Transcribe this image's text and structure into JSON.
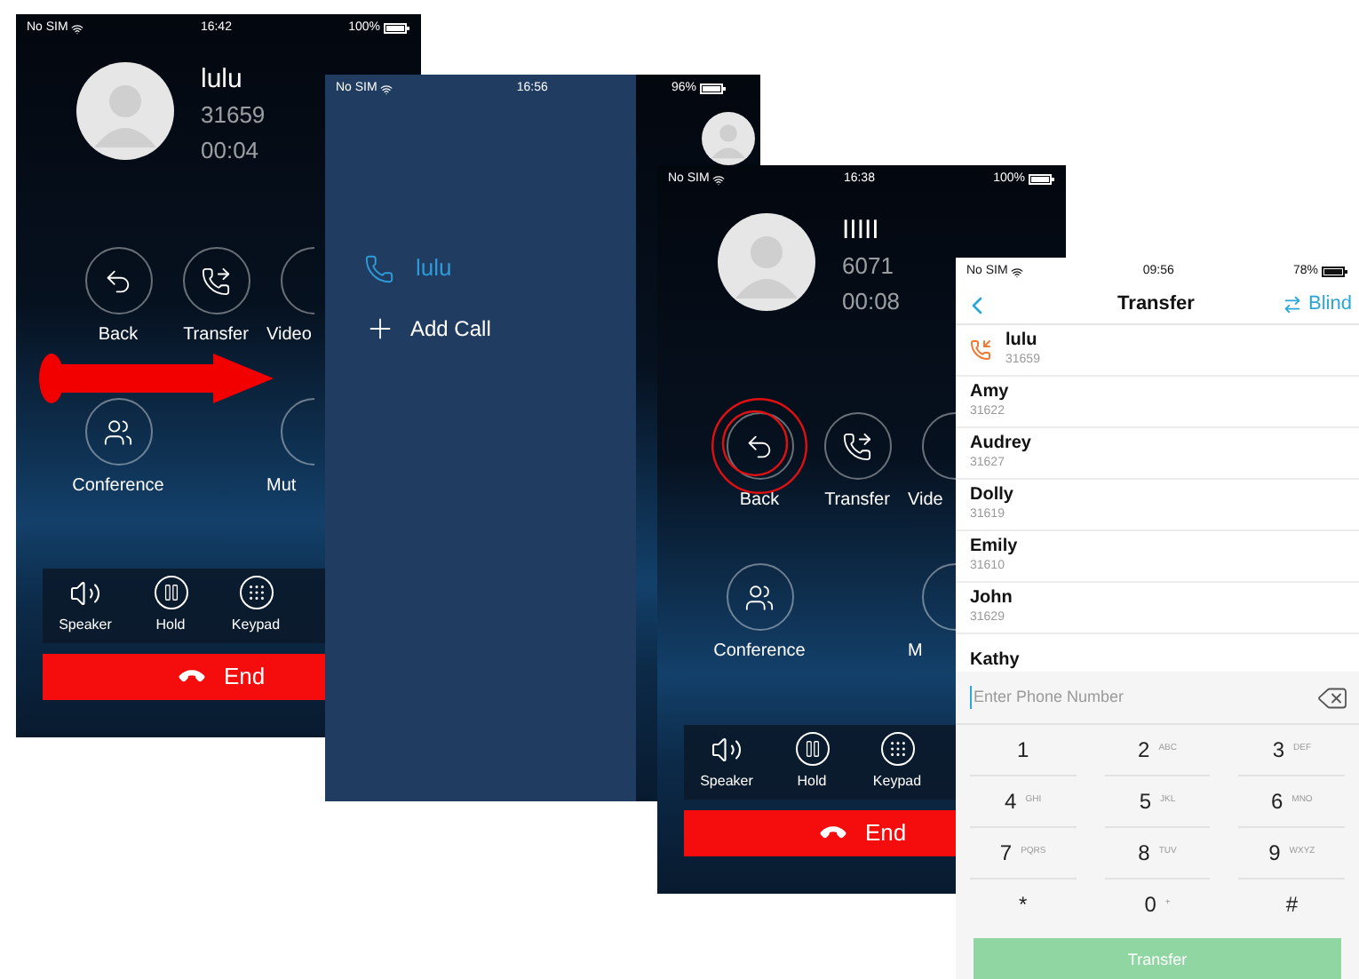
{
  "screens": [
    {
      "kind": "call",
      "status": {
        "carrier": "No SIM",
        "time": "16:42",
        "battery": "100%"
      },
      "contact": {
        "name": "lulu",
        "number": "31659",
        "duration": "00:04"
      },
      "action_rows": [
        [
          {
            "kind": "back",
            "label": "Back",
            "partly_hidden": false,
            "highlighted": false
          },
          {
            "kind": "transfer",
            "label": "Transfer",
            "partly_hidden": false,
            "highlighted": false
          },
          {
            "kind": "video",
            "label": "Video",
            "partly_hidden": true,
            "highlighted": false
          }
        ],
        [
          {
            "kind": "conference",
            "label": "Conference",
            "partly_hidden": false,
            "highlighted": false
          },
          {
            "kind": "mute",
            "label": "Mut",
            "partly_hidden": true,
            "highlighted": false
          }
        ]
      ],
      "controls": [
        {
          "kind": "speaker",
          "label": "Speaker"
        },
        {
          "kind": "hold",
          "label": "Hold"
        },
        {
          "kind": "keypad",
          "label": "Keypad"
        }
      ],
      "end_button": "End"
    },
    {
      "kind": "calls_menu",
      "status": {
        "carrier": "No SIM",
        "time": "16:56",
        "battery": "96%"
      },
      "items": [
        {
          "kind": "call",
          "label": "lulu"
        },
        {
          "kind": "add",
          "label": "Add Call"
        }
      ]
    },
    {
      "kind": "call",
      "status": {
        "carrier": "No SIM",
        "time": "16:38",
        "battery": "100%"
      },
      "contact": {
        "name": "IIIII",
        "number": "6071",
        "duration": "00:08"
      },
      "action_rows": [
        [
          {
            "kind": "back",
            "label": "Back",
            "partly_hidden": false,
            "highlighted": true
          },
          {
            "kind": "transfer",
            "label": "Transfer",
            "partly_hidden": false,
            "highlighted": false
          },
          {
            "kind": "video",
            "label": "Vide",
            "partly_hidden": true,
            "highlighted": false
          }
        ],
        [
          {
            "kind": "conference",
            "label": "Conference",
            "partly_hidden": false,
            "highlighted": false
          },
          {
            "kind": "mute",
            "label": "M",
            "partly_hidden": true,
            "highlighted": false
          }
        ]
      ],
      "controls": [
        {
          "kind": "speaker",
          "label": "Speaker"
        },
        {
          "kind": "hold",
          "label": "Hold"
        },
        {
          "kind": "keypad",
          "label": "Keypad"
        }
      ],
      "end_button": "End"
    },
    {
      "kind": "transfer",
      "status": {
        "carrier": "No SIM",
        "time": "09:56",
        "battery": "78%"
      },
      "title": "Transfer",
      "action": "Blind",
      "contacts": [
        {
          "kind": "current",
          "name": "lulu",
          "number": "31659"
        },
        {
          "kind": "contact",
          "name": "Amy",
          "number": "31622"
        },
        {
          "kind": "contact",
          "name": "Audrey",
          "number": "31627"
        },
        {
          "kind": "contact",
          "name": "Dolly",
          "number": "31619"
        },
        {
          "kind": "contact",
          "name": "Emily",
          "number": "31610"
        },
        {
          "kind": "contact",
          "name": "John",
          "number": "31629"
        },
        {
          "kind": "contact",
          "name": "Kathy"
        }
      ],
      "number_field": {
        "placeholder": "Enter Phone Number"
      },
      "keys": [
        {
          "digit": "1"
        },
        {
          "digit": "2",
          "letters": "ABC"
        },
        {
          "digit": "3",
          "letters": "DEF"
        },
        {
          "digit": "4",
          "letters": "GHI"
        },
        {
          "digit": "5",
          "letters": "JKL"
        },
        {
          "digit": "6",
          "letters": "MNO"
        },
        {
          "digit": "7",
          "letters": "PQRS"
        },
        {
          "digit": "8",
          "letters": "TUV"
        },
        {
          "digit": "9",
          "letters": "WXYZ"
        },
        {
          "digit": "*"
        },
        {
          "digit": "0",
          "letters": "+"
        },
        {
          "digit": "#"
        }
      ],
      "submit": "Transfer"
    }
  ]
}
